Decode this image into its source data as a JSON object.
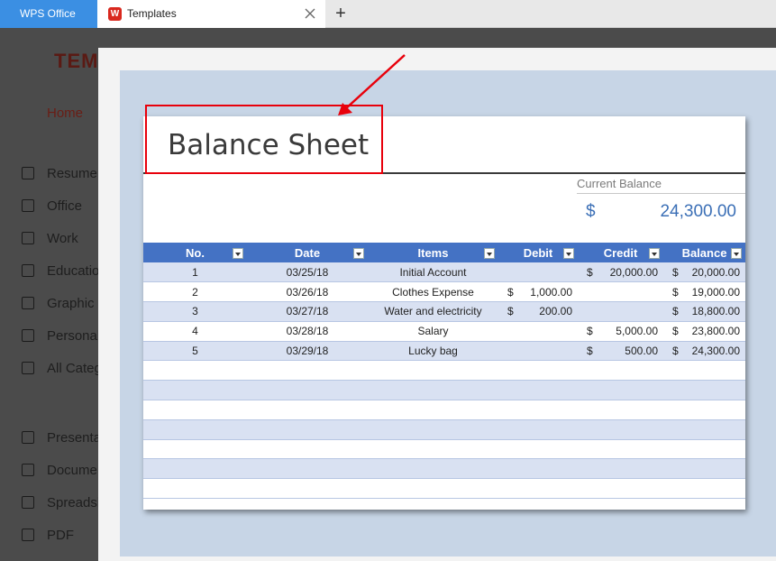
{
  "tabs": {
    "app_tab_label": "WPS Office",
    "templates_tab_label": "Templates",
    "templates_logo": "W",
    "close_icon": "close-icon",
    "add_tab": "+"
  },
  "background_app": {
    "header_logo": "TEM",
    "home_label": "Home",
    "sidebar": [
      {
        "label": "Resume"
      },
      {
        "label": "Office"
      },
      {
        "label": "Work"
      },
      {
        "label": "Educatio"
      },
      {
        "label": "Graphic"
      },
      {
        "label": "Personal"
      },
      {
        "label": "All Categ"
      },
      {
        "label": "Presenta"
      },
      {
        "label": "Docume"
      },
      {
        "label": "Spreadsh"
      },
      {
        "label": "PDF"
      }
    ]
  },
  "sheet": {
    "title": "Balance Sheet",
    "current_balance_label": "Current Balance",
    "current_balance_currency": "$",
    "current_balance_value": "24,300.00",
    "columns": [
      "No.",
      "Date",
      "Items",
      "Debit",
      "Credit",
      "Balance"
    ],
    "rows": [
      {
        "no": "1",
        "date": "03/25/18",
        "item": "Initial Account",
        "debit_cur": "",
        "debit": "",
        "credit_cur": "$",
        "credit": "20,000.00",
        "bal_cur": "$",
        "balance": "20,000.00"
      },
      {
        "no": "2",
        "date": "03/26/18",
        "item": "Clothes Expense",
        "debit_cur": "$",
        "debit": "1,000.00",
        "credit_cur": "",
        "credit": "",
        "bal_cur": "$",
        "balance": "19,000.00"
      },
      {
        "no": "3",
        "date": "03/27/18",
        "item": "Water and electricity",
        "debit_cur": "$",
        "debit": "200.00",
        "credit_cur": "",
        "credit": "",
        "bal_cur": "$",
        "balance": "18,800.00"
      },
      {
        "no": "4",
        "date": "03/28/18",
        "item": "Salary",
        "debit_cur": "",
        "debit": "",
        "credit_cur": "$",
        "credit": "5,000.00",
        "bal_cur": "$",
        "balance": "23,800.00"
      },
      {
        "no": "5",
        "date": "03/29/18",
        "item": "Lucky bag",
        "debit_cur": "",
        "debit": "",
        "credit_cur": "$",
        "credit": "500.00",
        "bal_cur": "$",
        "balance": "24,300.00"
      }
    ],
    "empty_row_count": 7
  },
  "annotation": {
    "color": "#e8000b"
  },
  "colors": {
    "header_blue": "#4472c4",
    "row_stripe": "#d9e1f2",
    "accent_blue": "#3b6fb6",
    "wps_tab": "#3b8fe3"
  }
}
